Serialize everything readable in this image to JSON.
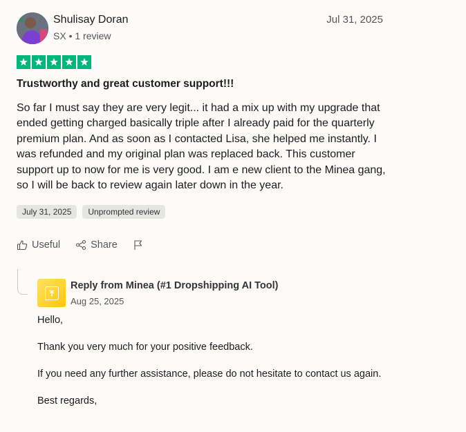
{
  "review": {
    "author_name": "Shulisay Doran",
    "author_meta": "SX • 1 review",
    "date": "Jul 31, 2025",
    "rating": 5,
    "star_color": "#00b67a",
    "title": "Trustworthy and great customer support!!!",
    "body": "So far I must say they are very legit... it had a mix up with my upgrade that ended getting charged basically triple after I already paid for the quarterly premium plan. And as soon as I contacted Lisa, she helped me instantly. I was refunded and my original plan was replaced back. This customer support up to now for me is very good. I am e new client to the Minea gang, so I will be back to review again later down in the year.",
    "tags": [
      "July 31, 2025",
      "Unprompted review"
    ]
  },
  "actions": {
    "useful_label": "Useful",
    "share_label": "Share"
  },
  "reply": {
    "title": "Reply from Minea (#1 Dropshipping AI Tool)",
    "date": "Aug 25, 2025",
    "paragraphs": [
      "Hello,",
      "Thank you very much for your positive feedback.",
      "If you need any further assistance, please do not hesitate to contact us again.",
      "Best regards,"
    ]
  }
}
